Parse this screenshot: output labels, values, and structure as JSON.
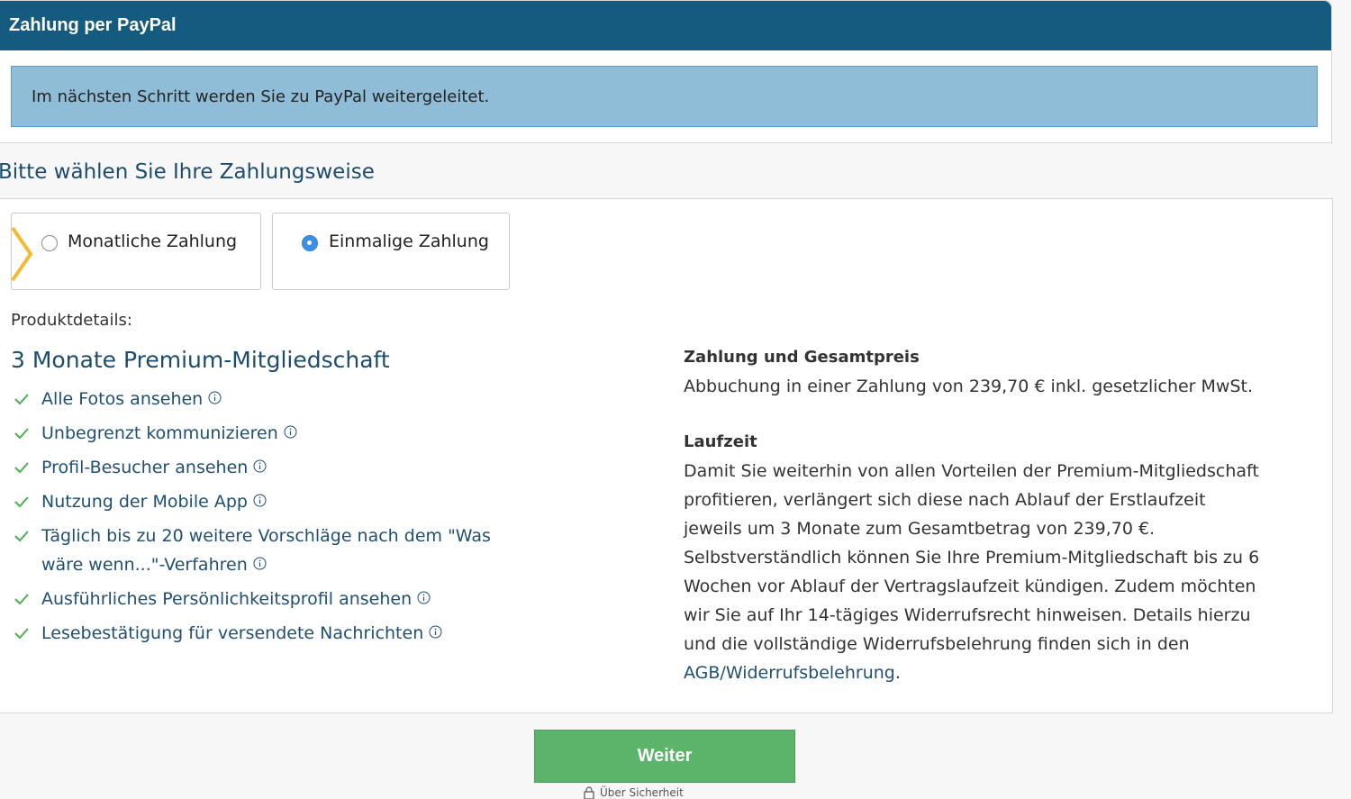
{
  "panel": {
    "title": "Zahlung per PayPal",
    "info": "Im nächsten Schritt werden Sie zu PayPal weitergeleitet."
  },
  "section_title": "Bitte wählen Sie Ihre Zahlungsweise",
  "payment_options": [
    {
      "label": "Monatliche Zahlung",
      "selected": false
    },
    {
      "label": "Einmalige Zahlung",
      "selected": true
    }
  ],
  "product": {
    "label": "Produktdetails:",
    "title": "3 Monate Premium-Mitgliedschaft",
    "features": [
      "Alle Fotos ansehen",
      "Unbegrenzt kommunizieren",
      "Profil-Besucher ansehen",
      "Nutzung der Mobile App",
      "Täglich bis zu 20 weitere Vorschläge nach dem \"Was wäre wenn...\"-Verfahren",
      "Ausführliches Persönlichkeitsprofil ansehen",
      "Lesebestätigung für versendete Nachrichten"
    ]
  },
  "payment_info": {
    "heading": "Zahlung und Gesamtpreis",
    "text": "Abbuchung in einer Zahlung von 239,70 € inkl. gesetzlicher MwSt."
  },
  "duration": {
    "heading": "Laufzeit",
    "text": "Damit Sie weiterhin von allen Vorteilen der Premium-Mitgliedschaft profitieren, verlängert sich diese nach Ablauf der Erstlaufzeit jeweils um 3 Monate zum Gesamtbetrag von 239,70 €. Selbstverständlich können Sie Ihre Premium-Mitgliedschaft bis zu 6 Wochen vor Ablauf der Vertragslaufzeit kündigen. Zudem möchten wir Sie auf Ihr 14-tägiges Widerrufsrecht hinweisen. Details hierzu und die vollständige Widerrufsbelehrung finden sich in den",
    "link": "AGB/Widerrufsbelehrung",
    "suffix": "."
  },
  "continue_button": "Weiter",
  "security_text": "Über Sicherheit",
  "colors": {
    "header": "#155b80",
    "info_box": "#8fbdd8",
    "accent_text": "#1d4d6e",
    "check": "#4caf50",
    "button": "#5cb36a",
    "chevron": "#f5b830",
    "radio_selected": "#3d8fe6"
  },
  "icons": {
    "check": "check-icon",
    "info": "info-icon",
    "lock": "lock-icon",
    "chevron": "chevron-right-icon"
  }
}
